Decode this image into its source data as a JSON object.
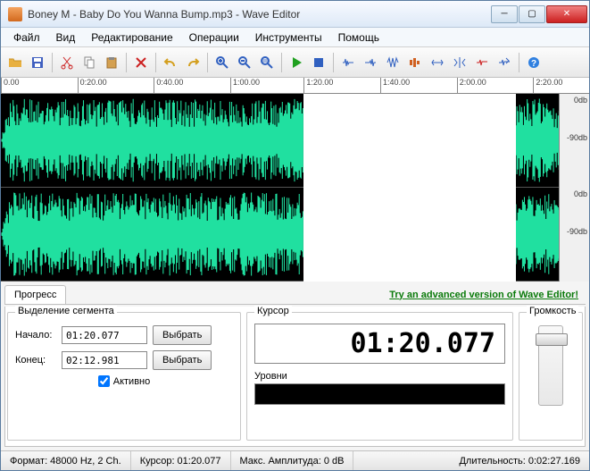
{
  "window": {
    "title": "Boney M - Baby Do You Wanna Bump.mp3 - Wave Editor"
  },
  "menu": [
    "Файл",
    "Вид",
    "Редактирование",
    "Операции",
    "Инструменты",
    "Помощь"
  ],
  "ruler": [
    "0.00",
    "0:20.00",
    "0:40.00",
    "1:00.00",
    "1:20.00",
    "1:40.00",
    "2:00.00",
    "2:20.00"
  ],
  "db_labels": [
    "0db",
    "-90db",
    "0db",
    "-90db"
  ],
  "tab": "Прогресс",
  "ad_link": "Try an advanced version of Wave Editor!",
  "segment": {
    "title": "Выделение сегмента",
    "start_label": "Начало:",
    "start_value": "01:20.077",
    "end_label": "Конец:",
    "end_value": "02:12.981",
    "select_btn": "Выбрать",
    "active_label": "Активно"
  },
  "cursor": {
    "title": "Курсор",
    "value": "01:20.077",
    "levels_label": "Уровни"
  },
  "volume": {
    "title": "Громкость"
  },
  "status": {
    "format": "Формат: 48000 Hz, 2 Ch.",
    "cursor": "Курсор: 01:20.077",
    "amplitude": "Макс. Амплитуда: 0 dB",
    "duration": "Длительность: 0:02:27.169"
  },
  "selection": {
    "start_pct": 51.5,
    "width_pct": 36.0
  },
  "toolbar_icons": [
    "open",
    "save",
    "cut",
    "copy",
    "paste",
    "delete",
    "undo",
    "redo",
    "zoom-in",
    "zoom-out",
    "zoom-sel",
    "play",
    "stop",
    "fx1",
    "fx2",
    "fx3",
    "fx4",
    "fx5",
    "fx6",
    "fx7",
    "fx8",
    "help"
  ]
}
